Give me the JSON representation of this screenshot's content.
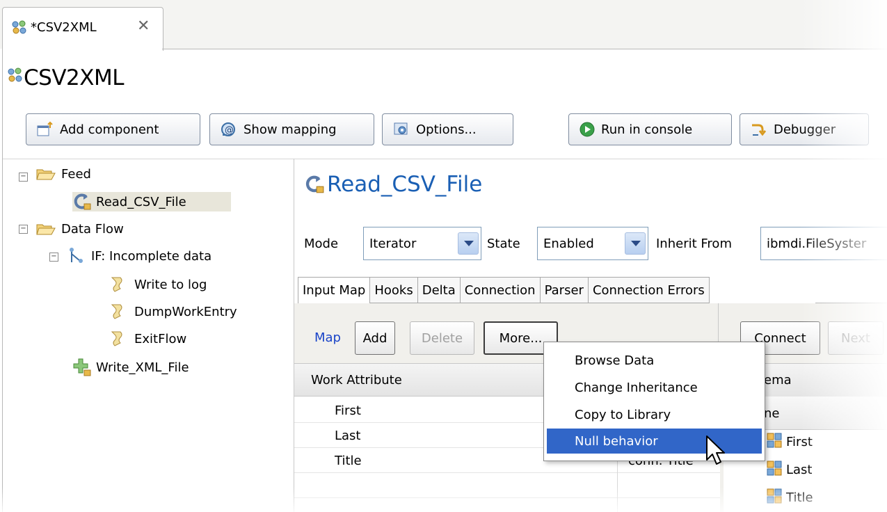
{
  "editor_tab": {
    "label": "*CSV2XML",
    "icon": "config-icon"
  },
  "page_title": "CSV2XML",
  "toolbar": {
    "add_component": "Add component",
    "show_mapping": "Show mapping",
    "options": "Options...",
    "run_in_console": "Run in console",
    "debugger": "Debugger"
  },
  "tree": {
    "feed": "Feed",
    "read_csv_file": "Read_CSV_File",
    "data_flow": "Data Flow",
    "if_node": "IF: Incomplete data",
    "write_to_log": "Write to log",
    "dump_work_entry": "DumpWorkEntry",
    "exit_flow": "ExitFlow",
    "write_xml_file": "Write_XML_File"
  },
  "component": {
    "title": "Read_CSV_File",
    "mode_label": "Mode",
    "mode_value": "Iterator",
    "state_label": "State",
    "state_value": "Enabled",
    "inherit_label": "Inherit From",
    "inherit_value": "ibmdi.FileSyster"
  },
  "tabs": [
    "Input Map",
    "Hooks",
    "Delta",
    "Connection",
    "Parser",
    "Connection Errors"
  ],
  "map_panel": {
    "map_link": "Map",
    "add": "Add",
    "delete": "Delete",
    "more": "More...",
    "connect": "Connect",
    "next": "Next"
  },
  "table": {
    "header": "Work Attribute",
    "rows": [
      {
        "attr": "First",
        "value": ""
      },
      {
        "attr": "Last",
        "value": ""
      },
      {
        "attr": "Title",
        "value": "conn. Title"
      }
    ]
  },
  "schema": {
    "header": "ema",
    "name_header": "ne",
    "items": [
      "First",
      "Last",
      "Title"
    ]
  },
  "menu": {
    "items": [
      "Browse Data",
      "Change Inheritance",
      "Copy to Library",
      "Null behavior"
    ],
    "highlighted": "Null behavior"
  },
  "colors": {
    "accent_blue": "#1a5fb4",
    "menu_highlight": "#3166c8"
  }
}
